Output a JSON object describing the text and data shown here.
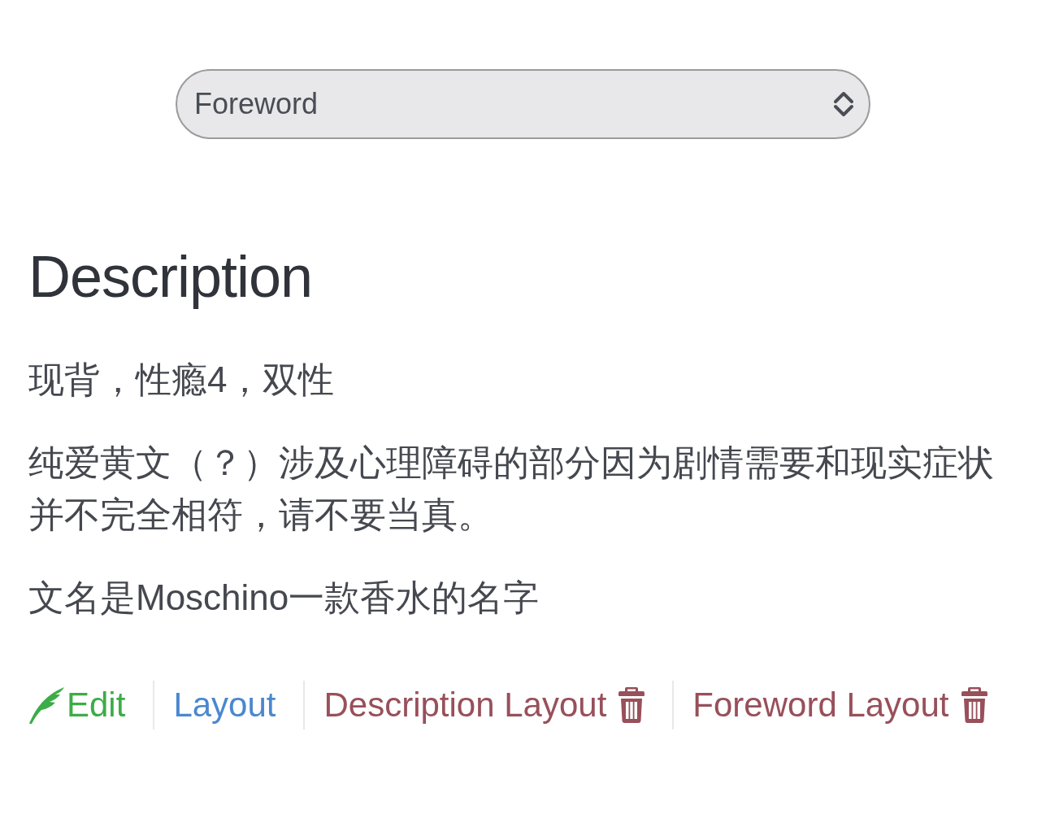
{
  "select": {
    "value": "Foreword"
  },
  "section": {
    "heading": "Description",
    "paragraphs": [
      "现背，性瘾4，双性",
      "纯爱黄文（？）涉及心理障碍的部分因为剧情需要和现实症状并不完全相符，请不要当真。",
      "文名是Moschino一款香水的名字"
    ]
  },
  "actions": [
    {
      "kind": "edit",
      "label": "Edit",
      "color": "#3dac48"
    },
    {
      "kind": "layout",
      "label": "Layout",
      "color": "#4a88cf"
    },
    {
      "kind": "delete",
      "label": "Description Layout",
      "color": "#98505a"
    },
    {
      "kind": "delete",
      "label": "Foreword Layout",
      "color": "#98505a"
    }
  ]
}
